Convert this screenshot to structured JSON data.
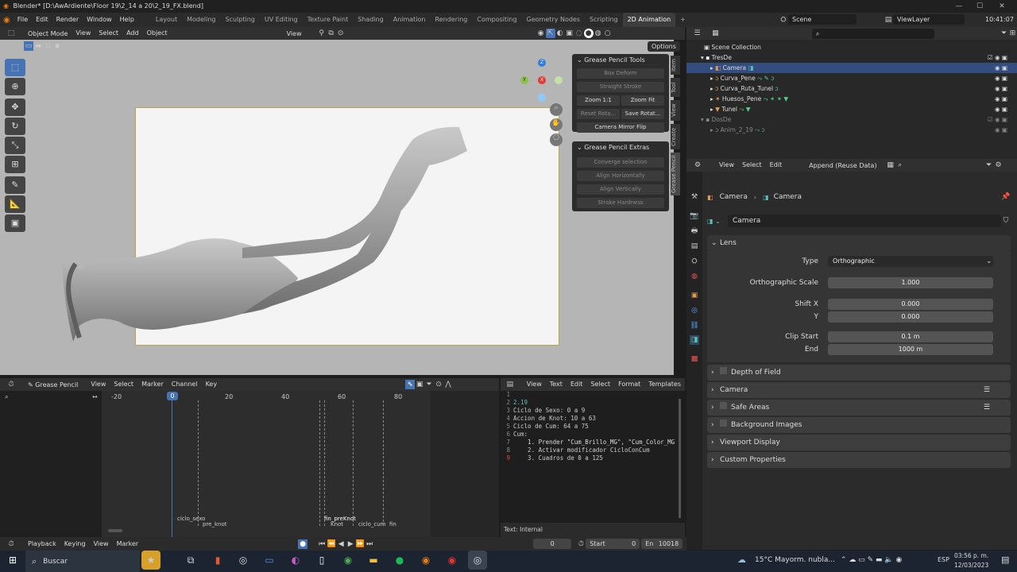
{
  "titlebar": {
    "title": "Blender* [D:\\AwArdiente\\Floor 19\\2_14 a 20\\2_19_FX.blend]",
    "min": "—",
    "max": "☐",
    "close": "✕"
  },
  "menu": {
    "items": [
      "File",
      "Edit",
      "Render",
      "Window",
      "Help"
    ],
    "workspaces": [
      "Layout",
      "Modeling",
      "Sculpting",
      "UV Editing",
      "Texture Paint",
      "Shading",
      "Animation",
      "Rendering",
      "Compositing",
      "Geometry Nodes",
      "Scripting",
      "2D Animation"
    ],
    "active_workspace": "2D Animation",
    "scene": "Scene",
    "view_layer": "ViewLayer",
    "time": "10:41:07"
  },
  "viewport": {
    "mode": "Object Mode",
    "menus": [
      "View",
      "Select",
      "Add",
      "Object"
    ],
    "view_label": "View",
    "options_label": "Options",
    "panel_title": "Grease Pencil Tools",
    "panel_buttons": {
      "box_deform": "Box Deform",
      "straight_stroke": "Straight Stroke",
      "zoom1": "Zoom 1:1",
      "zoom_fit": "Zoom Fit",
      "reset_rota": "Reset Rota...",
      "save_rota": "Save Rotat...",
      "mirror_flip": "Camera Mirror Flip"
    },
    "extras_title": "Grease Pencil Extras",
    "extras_buttons": [
      "Converge selection",
      "Align Horizontally",
      "Align Vertically",
      "Stroke Hardness"
    ],
    "side_tabs": [
      "Item",
      "Tool",
      "View",
      "Create",
      "Grease Pencil"
    ],
    "gizmo": {
      "z": "Z",
      "y": "Y",
      "x": "X"
    }
  },
  "outliner": {
    "root": "Scene Collection",
    "items": [
      {
        "name": "TresDe",
        "indent": 1
      },
      {
        "name": "Camera",
        "indent": 2,
        "selected": true
      },
      {
        "name": "Curva_Pene",
        "indent": 2
      },
      {
        "name": "Curva_Ruta_Tunel",
        "indent": 2
      },
      {
        "name": "Huesos_Pene",
        "indent": 2
      },
      {
        "name": "Tunel",
        "indent": 2
      },
      {
        "name": "DosDe",
        "indent": 1,
        "dim": true
      },
      {
        "name": "Anim_2_19",
        "indent": 2,
        "dim": true
      }
    ]
  },
  "properties": {
    "menus": [
      "View",
      "Select",
      "Edit"
    ],
    "append": "Append (Reuse Data)",
    "breadcrumb1": "Camera",
    "breadcrumb2": "Camera",
    "datablock": "Camera",
    "lens_title": "Lens",
    "type_label": "Type",
    "type_value": "Orthographic",
    "ortho_label": "Orthographic Scale",
    "ortho_value": "1.000",
    "shiftx_label": "Shift X",
    "shiftx_value": "0.000",
    "shifty_label": "Y",
    "shifty_value": "0.000",
    "clipstart_label": "Clip Start",
    "clipstart_value": "0.1 m",
    "end_label": "End",
    "end_value": "1000 m",
    "sections": [
      "Depth of Field",
      "Camera",
      "Safe Areas",
      "Background Images",
      "Viewport Display",
      "Custom Properties"
    ]
  },
  "dopesheet": {
    "mode": "Grease Pencil",
    "menus": [
      "View",
      "Select",
      "Marker",
      "Channel",
      "Key"
    ],
    "frames": [
      "-20",
      "0",
      "20",
      "40",
      "60",
      "80"
    ],
    "current": "0",
    "markers": [
      "ciclo_sexo",
      "pre_knot",
      "fin_preKnot",
      "Knot",
      "ciclo_cum",
      "fin"
    ]
  },
  "text_editor": {
    "menus": [
      "View",
      "Text",
      "Edit",
      "Select",
      "Format",
      "Templates"
    ],
    "lines": [
      "2.19",
      "Ciclo de Sexo: 0 a 9",
      "Accion de Knot: 10 a 63",
      "",
      "Ciclo de Cum: 64 a 75",
      "Cum:",
      "    1. Prender \"Cum_Brillo_MG\", \"Cum_Color_MG",
      "    2. Activar modificador CicloConCum",
      "    3. Cuadros de 0 a 125"
    ],
    "status": "Text: Internal"
  },
  "timeline": {
    "playback": "Playback",
    "keying": "Keying",
    "view": "View",
    "marker": "Marker",
    "frame": "0",
    "start_label": "Start",
    "start": "0",
    "end_label": "En",
    "end": "10018"
  },
  "taskbar": {
    "search": "Buscar",
    "weather": "15°C  Mayorm. nubla...",
    "lang": "ESP",
    "time": "03:56 p. m.",
    "date": "12/03/2023"
  }
}
